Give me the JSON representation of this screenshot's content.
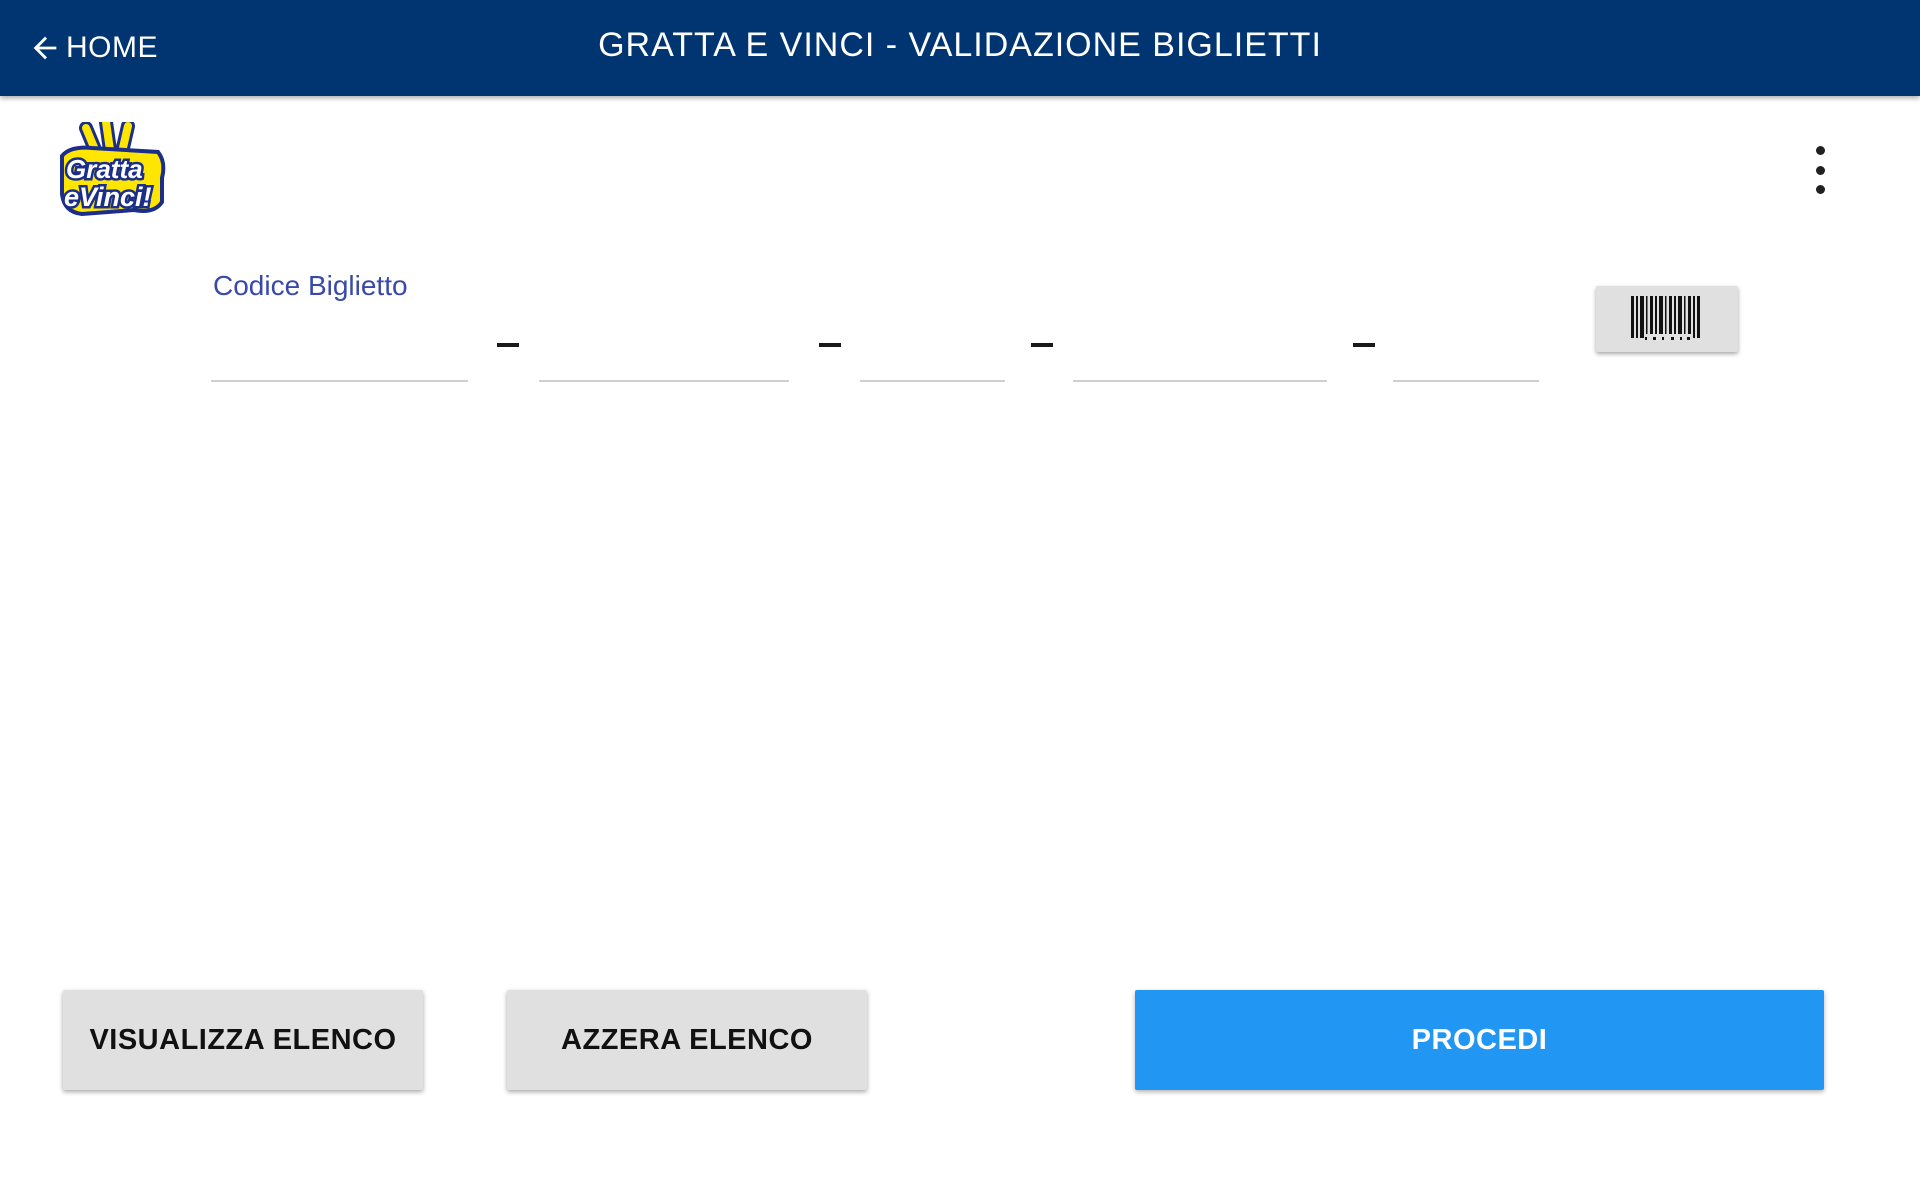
{
  "appbar": {
    "back_label": "HOME",
    "back_icon": "arrow-left-icon",
    "title": "GRATTA E VINCI - VALIDAZIONE BIGLIETTI",
    "background_color": "#003571"
  },
  "logo": {
    "text_line1": "Gratta",
    "text_line2": "eVinci!",
    "primary_color": "#ffe600",
    "outline_color": "#1b2f8a"
  },
  "menu": {
    "icon": "more-vertical-icon"
  },
  "ticket_code": {
    "label": "Codice Biglietto",
    "fields": [
      {
        "value": "",
        "placeholder": ""
      },
      {
        "value": "",
        "placeholder": ""
      },
      {
        "value": "",
        "placeholder": ""
      },
      {
        "value": "",
        "placeholder": ""
      },
      {
        "value": "",
        "placeholder": ""
      }
    ],
    "separator": "–",
    "scan_icon": "barcode-icon"
  },
  "actions": {
    "view_list": "VISUALIZZA ELENCO",
    "clear_list": "AZZERA ELENCO",
    "proceed": "PROCEDI",
    "proceed_color": "#2196f3"
  }
}
